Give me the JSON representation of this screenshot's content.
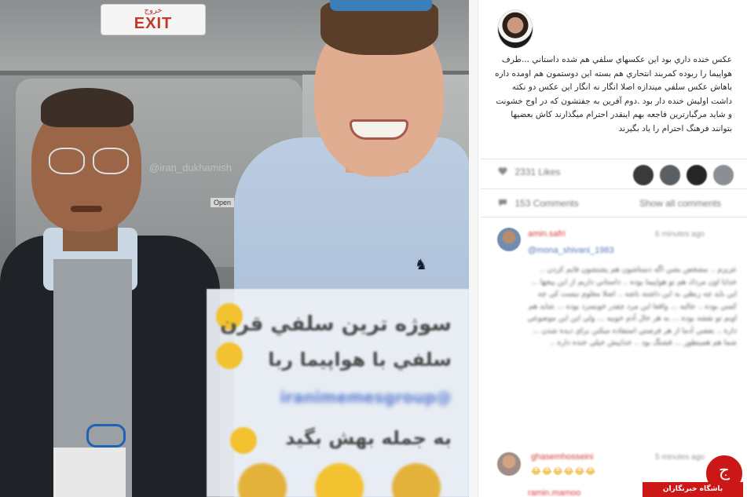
{
  "photo": {
    "exit_sign_arabic": "خروج",
    "exit_sign_text": "EXIT",
    "door_label": "Open",
    "watermark": "@iran_dukhamish",
    "overlay_lines": [
      "سوژه ترين سلفي قرن",
      "سلفي با هواپيما ربا",
      "@iranimemesgroup",
      "به جمله بهش بگيد"
    ],
    "overlay_emoji_names": [
      "crying-laughing-icon",
      "crying-laughing-icon",
      "smiling-icon",
      "monkey-icon",
      "sobbing-icon",
      "monkey-icon"
    ],
    "shirt_logo": "♞"
  },
  "post": {
    "caption": "عكس خنده داري بود اين عكسهاي سلفي هم شده داستاني ...طرف هواپيما را ربوده كمربند انتحاري هم بسته اين دوستمون هم اومده داره باهاش عكس سلفي ميندازه اصلا انگار نه انگار اين عكس دو نكته داشت اوليش خنده دار بود .دوم آفرين به جفتشون كه در اوج خشونت و شايد مرگبارترين فاجعه بهم اينقدر احترام ميگذارند كاش بعضيها بتوانند فرهنگ احترام را ياد بگيرند",
    "likes_text": "2331 Likes",
    "comments_text": "153 Comments",
    "show_all_text": "Show all comments",
    "liker_colors": [
      "#3a3a3a",
      "#5a5f63",
      "#262626",
      "#8a8f95"
    ]
  },
  "comments": [
    {
      "username": "amin.safri",
      "time": "6 minutes ago",
      "mention": "@mona_shivani_1983",
      "body": "عزيزم .. مشخص بشي اگه دستاشون هم پشتشون قايم كردن .. خدايا اون مردك هم تو هواپيما بوده .. داستاني داريم از اين پيجها ... اين بايد چه ربطي به اين داشته باشه .. اصلا معلوم نيست كي چه كسي بوده .. جالبه ... واقعا اين مرد چقدر خونسرد بوده ... شايد هم اونم تو نقشه بوده ... به هر حال آدم خوبيه ... ولي اين اين موضوعي داره .. بعضي آدما از هر فرصتي استفاده ميكنن براي ديده شدن ... شما هم همينطور ... قشنگ بود .. خداييش خيلي خنده داره ..",
      "avatar_color": "#6f8db1"
    },
    {
      "username": "ghasemhosseini",
      "time": "5 minutes ago",
      "emojis": "😂😂😂😂😂😂",
      "avatar_color": "#9f8d86"
    },
    {
      "username": "ramin.mamoo",
      "time": ""
    }
  ],
  "site": {
    "badge_text": "باشگاه خبرنگاران",
    "logo_glyph": "ج"
  }
}
